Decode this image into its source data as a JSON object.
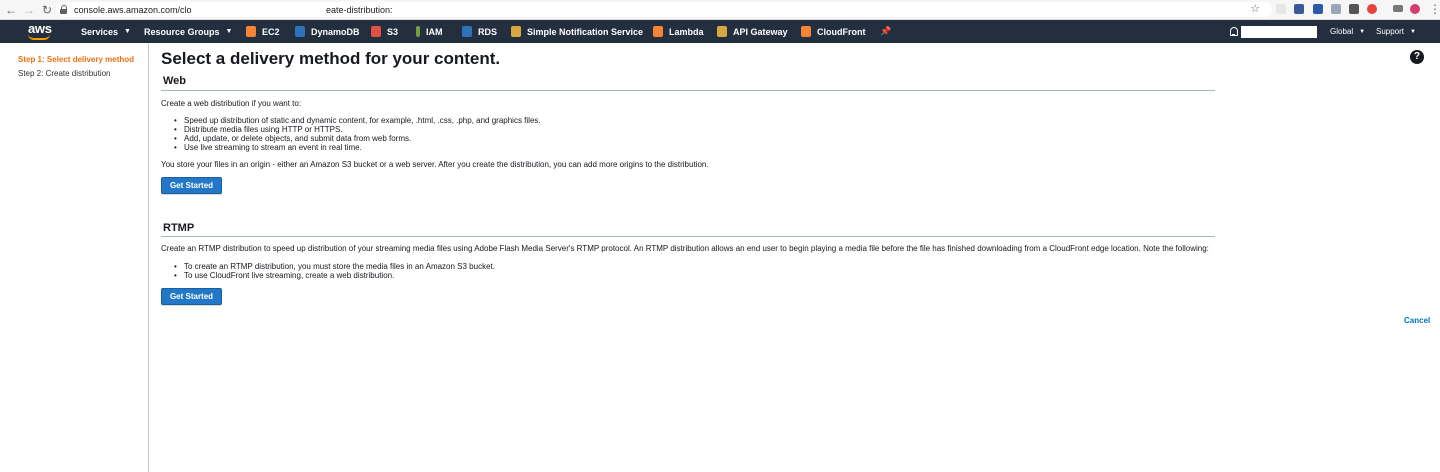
{
  "browser": {
    "url_host": "console.aws.amazon.com/clo",
    "url_rest": "eate-distribution:"
  },
  "nav": {
    "services": "Services",
    "resource_groups": "Resource Groups",
    "services_list": [
      {
        "label": "EC2",
        "color": "#f58534"
      },
      {
        "label": "DynamoDB",
        "color": "#2e73b8"
      },
      {
        "label": "S3",
        "color": "#e05243"
      },
      {
        "label": "IAM",
        "color": "#759c3e"
      },
      {
        "label": "RDS",
        "color": "#2e73b8"
      },
      {
        "label": "Simple Notification Service",
        "color": "#d9a741"
      },
      {
        "label": "Lambda",
        "color": "#f58534"
      },
      {
        "label": "API Gateway",
        "color": "#d9a741"
      },
      {
        "label": "CloudFront",
        "color": "#f58534"
      }
    ],
    "region": "Global",
    "support": "Support"
  },
  "sidebar": {
    "step1": "Step 1: Select delivery method",
    "step2": "Step 2: Create distribution"
  },
  "main": {
    "title": "Select a delivery method for your content.",
    "web": {
      "heading": "Web",
      "intro": "Create a web distribution if you want to:",
      "bullets": [
        "Speed up distribution of static and dynamic content, for example, .html, .css, .php, and graphics files.",
        "Distribute media files using HTTP or HTTPS.",
        "Add, update, or delete objects, and submit data from web forms.",
        "Use live streaming to stream an event in real time."
      ],
      "note": "You store your files in an origin - either an Amazon S3 bucket or a web server. After you create the distribution, you can add more origins to the distribution.",
      "button": "Get Started"
    },
    "rtmp": {
      "heading": "RTMP",
      "intro": "Create an RTMP distribution to speed up distribution of your streaming media files using Adobe Flash Media Server's RTMP protocol. An RTMP distribution allows an end user to begin playing a media file before the file has finished downloading from a CloudFront edge location. Note the following:",
      "bullets": [
        "To create an RTMP distribution, you must store the media files in an Amazon S3 bucket.",
        "To use CloudFront live streaming, create a web distribution."
      ],
      "button": "Get Started"
    },
    "cancel": "Cancel",
    "help_glyph": "?"
  },
  "colors": {
    "aws_nav_bg": "#232f3e",
    "aws_orange": "#ff9900",
    "active_step": "#ec7211",
    "primary_button": "#2278c6",
    "link": "#0073bb"
  },
  "icons": {
    "back": "back-arrow-icon",
    "forward": "forward-arrow-icon",
    "reload": "reload-icon",
    "lock": "lock-icon",
    "bookmark": "star-icon",
    "pin": "pin-icon",
    "bell": "bell-icon",
    "help": "help-icon"
  }
}
